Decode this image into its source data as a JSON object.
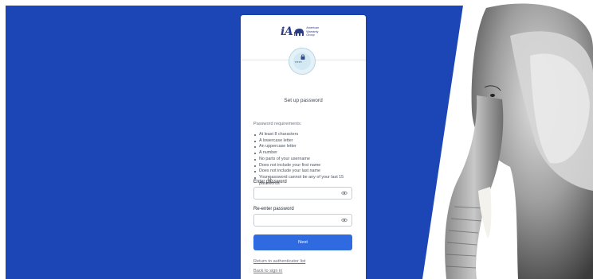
{
  "brand": {
    "logo_text": "iA",
    "logo_subtext": "American Warranty Group"
  },
  "card": {
    "title": "Set up password",
    "requirements_heading": "Password requirements:",
    "requirements": [
      "At least 8 characters",
      "A lowercase letter",
      "An uppercase letter",
      "A number",
      "No parts of your username",
      "Does not include your first name",
      "Does not include your last name",
      "Your password cannot be any of your last 15 passwords"
    ],
    "enter_password": {
      "label": "Enter password",
      "value": ""
    },
    "reenter_password": {
      "label": "Re-enter password",
      "value": ""
    },
    "next_label": "Next",
    "return_link": "Return to authenticator list",
    "back_link": "Back to sign in"
  },
  "icons": {
    "auth": "lock-icon",
    "password_dots": "****",
    "field_toggle": "eye-icon"
  },
  "colors": {
    "background_blue": "#1c46b5",
    "primary_button": "#2f6ae0",
    "brand_navy": "#2a3b86"
  }
}
